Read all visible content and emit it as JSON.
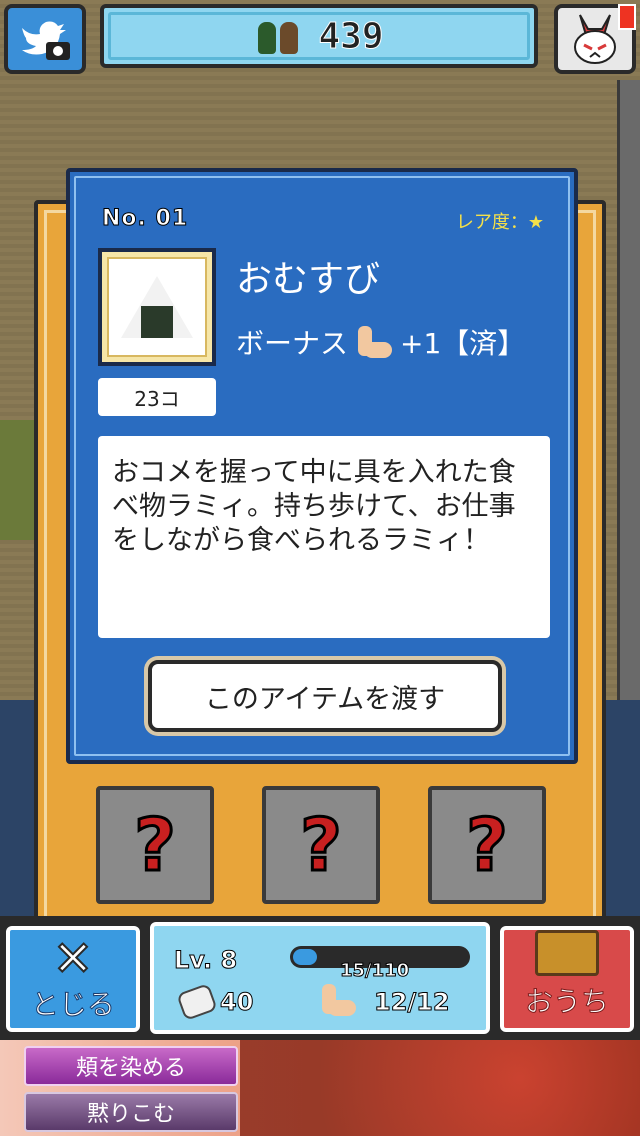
{
  "top_bar": {
    "counter_value": "439",
    "people_icon": "villagers-icon",
    "twitter_icon": "twitter-camera-icon",
    "menu_icon": "rabbit-mask-icon"
  },
  "item_card": {
    "number_label": "No. 01",
    "rarity_label": "レア度：★",
    "name": "おむすび",
    "bonus_prefix": "ボーナス",
    "bonus_icon": "muscle-arm-icon",
    "bonus_value": "+1【済】",
    "quantity": "23コ",
    "description": "おコメを握って中に具を入れた食べ物ラミィ。持ち歩けて、お仕事をしながら食べられるラミィ！",
    "give_button": "このアイテムを渡す"
  },
  "slots": [
    {
      "label": "?"
    },
    {
      "label": "?"
    },
    {
      "label": "?"
    }
  ],
  "hud": {
    "close_label": "とじる",
    "level": "Lv. 8",
    "xp_text": "15/110",
    "xp_fraction": 0.136,
    "stat_a": "40",
    "stat_b": "12/12",
    "home_label": "おうち"
  },
  "ad": {
    "button1": "頬を染める",
    "button2": "黙りこむ"
  },
  "colors": {
    "card_blue": "#2a6cc0",
    "frame_orange": "#e8a53a",
    "hud_cyan": "#8fd6f0",
    "close_blue": "#3a9ae0",
    "home_red": "#d84a4a"
  }
}
